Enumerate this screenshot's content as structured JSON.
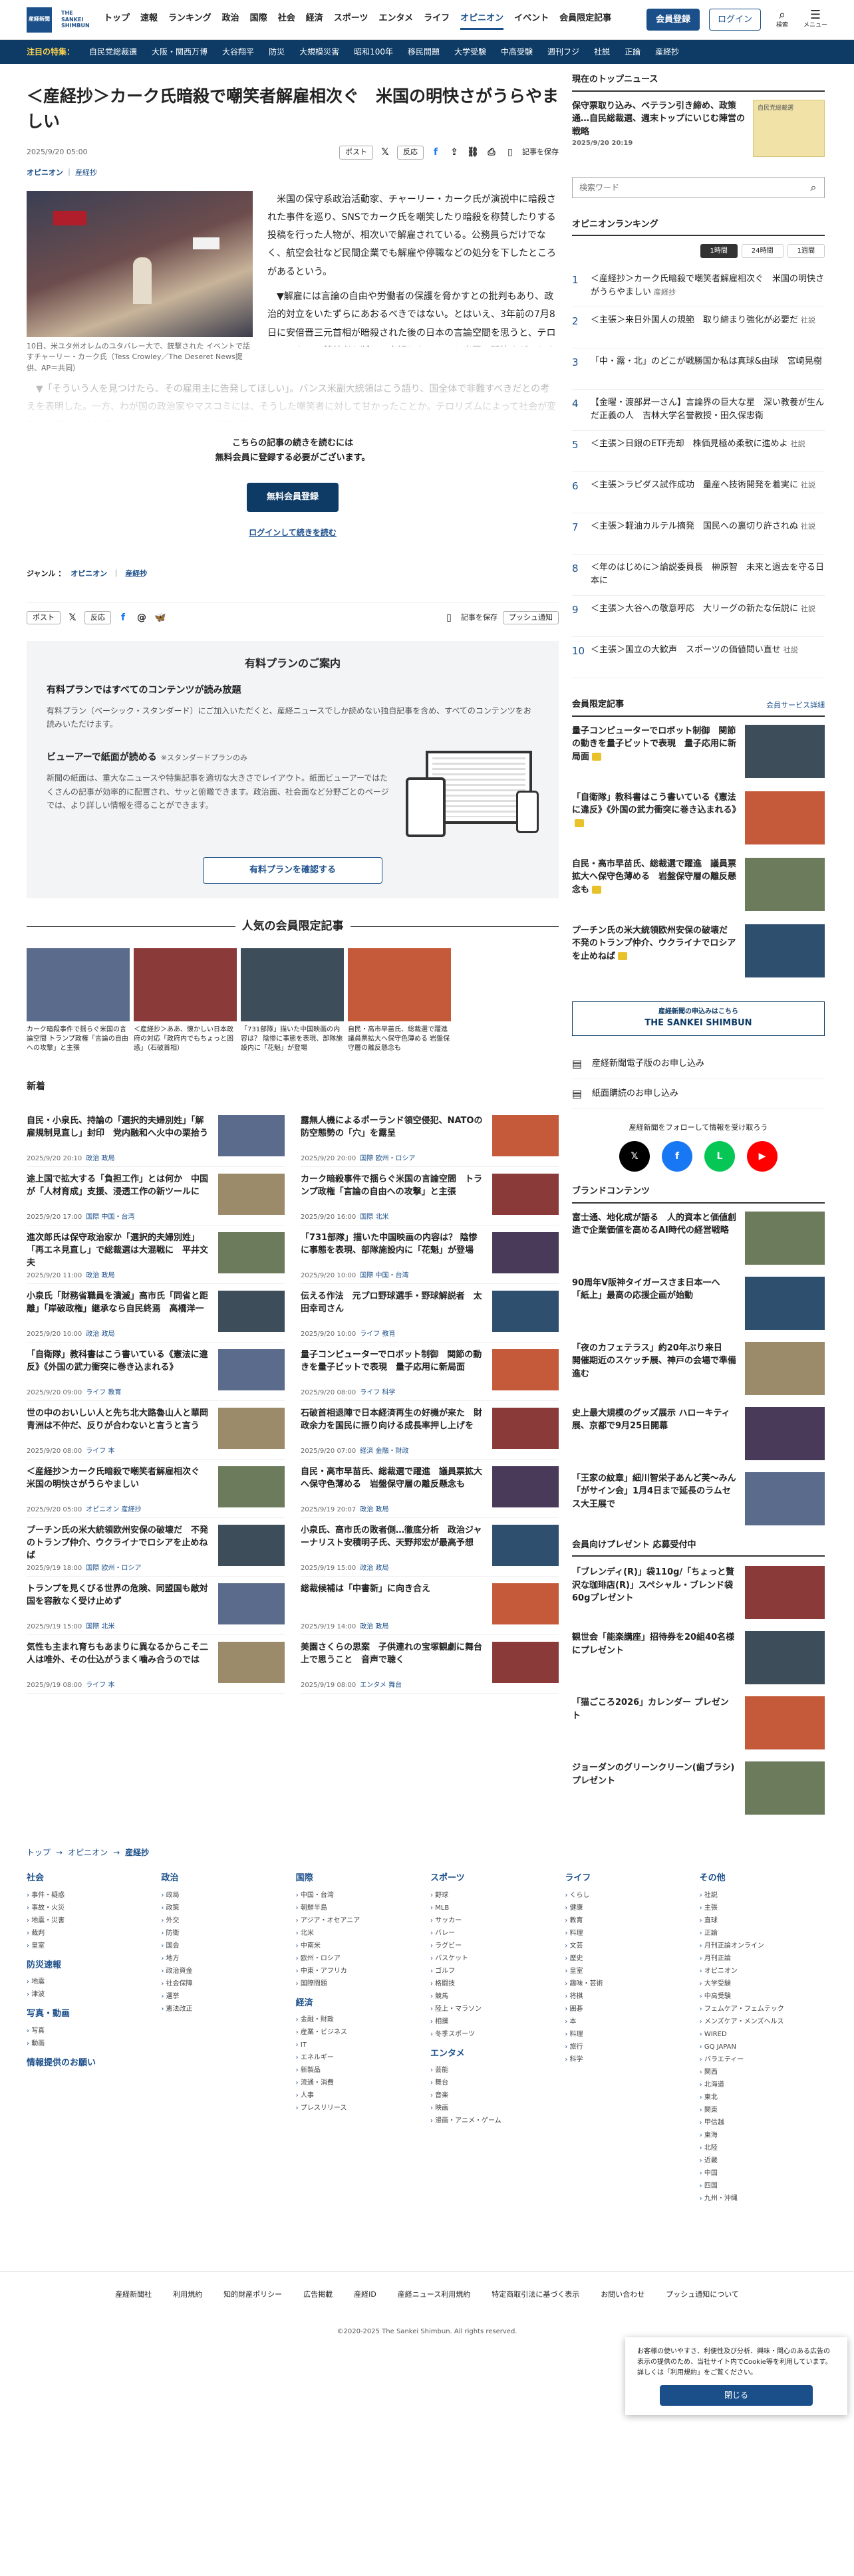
{
  "header": {
    "logo_line1": "産経",
    "logo_line2": "新聞",
    "logo_text": "THE SANKEI SHIMBUN",
    "nav": [
      "トップ",
      "速報",
      "ランキング",
      "政治",
      "国際",
      "社会",
      "経済",
      "スポーツ",
      "エンタメ",
      "ライフ",
      "オピニオン",
      "イベント",
      "会員限定記事"
    ],
    "register": "会員登録",
    "login": "ログイン",
    "search_label": "検索",
    "menu_label": "メニュー"
  },
  "topics": {
    "label": "注目の特集：",
    "items": [
      "自民党総裁選",
      "大阪・関西万博",
      "大谷翔平",
      "防災",
      "大規模災害",
      "昭和100年",
      "移民問題",
      "大学受験",
      "中高受験",
      "週刊フジ",
      "社説",
      "正論",
      "産経抄"
    ]
  },
  "article": {
    "title": "＜産経抄＞カーク氏暗殺で嘲笑者解雇相次ぐ　米国の明快さがうらやましい",
    "date": "2025/9/20 05:00",
    "category": "オピニオン",
    "subcategory": "産経抄",
    "share": {
      "post": "ポスト",
      "react": "反応",
      "save": "記事を保存"
    },
    "caption": "10日、米ユタ州オレムのユタバレー大で、銃撃された イベントで話すチャーリー・カーク氏（Tess Crowley／The Deseret News提供、AP＝共同）",
    "p1": "米国の保守系政治活動家、チャーリー・カーク氏が演説中に暗殺された事件を巡り、SNSでカーク氏を嘲笑したり暗殺を称賛したりする投稿を行った人物が、相次いで解雇されている。公務員らだけでなく、航空会社など民間企業でも解雇や停職などの処分を下したところがあるという。",
    "p2": "▼解雇には言論の自由や労働者の保護を脅かすとの批判もあり、政治的対立をいたずらにあおるべきではない。とはいえ、3年前の7月8日に安倍晋三元首相が暗殺された後の日本の言論空間を思うと、テロリストもその賛美者も断じて容認しないという米国の明快さがうらやましい。",
    "p3": "▼「そういう人を見つけたら、その雇用主に告発してほしい」。バンス米副大統領はこう語り、国全体で非難すべきだとの考えを表明した。一方、わが国の政治家やマスコミには、そうした嘲笑者に対して甘かったことか。テロリズムによって社会が変容し、民主主義が揺さぶられていくことに危機感を抱いた"
  },
  "paywall": {
    "line1": "こちらの記事の続きを読むには",
    "line2": "無料会員に登録する必要がございます。",
    "button": "無料会員登録",
    "login": "ログインして続きを読む"
  },
  "genre": {
    "label": "ジャンル ：",
    "cat": "オピニオン",
    "sub": "産経抄"
  },
  "share2": {
    "post": "ポスト",
    "react": "反応",
    "save": "記事を保存",
    "push": "プッシュ通知"
  },
  "plan": {
    "title": "有料プランのご案内",
    "h1": "有料プランではすべてのコンテンツが読み放題",
    "t1": "有料プラン（ベーシック・スタンダード）にご加入いただくと、産経ニュースでしか読めない独自記事を含め、すべてのコンテンツをお読みいただけます。",
    "h2": "ビューアーで紙面が読める",
    "tag2": "※スタンダードプランのみ",
    "t2": "新聞の紙面は、重大なニュースや特集記事を適切な大きさでレイアウト。紙面ビューアーではたくさんの記事が効率的に配置され、サッと俯瞰できます。政治面、社会面など分野ごとのページでは、より詳しい情報を得ることができます。",
    "button": "有料プランを確認する"
  },
  "popular": {
    "title": "人気の会員限定記事",
    "items": [
      "カーク暗殺事件で揺らぐ米国の言論空間 トランプ政権「言論の自由への攻撃」と主張",
      "＜産経抄＞ああ、懐かしい日本政府の対応「政府内でもちょっと困惑」（石破首相）",
      "「731部隊」描いた中国映画の内容は？ 陰惨に事態を表現、部隊施設内に「花魁」が登場",
      "自民・高市早苗氏、総裁選で躍進 議員票拡大へ保守色薄める 岩盤保守層の離反懸念も"
    ]
  },
  "news": {
    "title": "新着",
    "items": [
      {
        "t": "自民・小泉氏、持論の「選択的夫婦別姓」「解雇規制見直し」封印　党内融和へ火中の栗拾う",
        "d": "2025/9/20 20:10",
        "k": "政治 政局"
      },
      {
        "t": "露無人機によるポーランド領空侵犯、NATOの防空態勢の「穴」を露呈",
        "d": "2025/9/20 20:00",
        "k": "国際 欧州・ロシア"
      },
      {
        "t": "途上国で拡大する「負担工作」とは何か　中国が「人材育成」支援、浸透工作の新ツールに",
        "d": "2025/9/20 17:00",
        "k": "国際 中国・台湾"
      },
      {
        "t": "カーク暗殺事件で揺らぐ米国の言論空間　トランプ政権「言論の自由への攻撃」と主張",
        "d": "2025/9/20 16:00",
        "k": "国際 北米"
      },
      {
        "t": "進次郎氏は保守政治家か「選択的夫婦別姓」「再エネ見直し」で総裁選は大混戦に　平井文夫",
        "d": "2025/9/20 11:00",
        "k": "政治 政局"
      },
      {
        "t": "「731部隊」描いた中国映画の内容は？ 陰惨に事態を表現、部隊施設内に「花魁」が登場",
        "d": "2025/9/20 10:00",
        "k": "国際 中国・台湾"
      },
      {
        "t": "小泉氏「財務省職員を潰滅」高市氏「同省と距離」「岸破政権」継承なら自民終焉　高橋洋一",
        "d": "2025/9/20 10:00",
        "k": "政治 政局"
      },
      {
        "t": "伝える作法　元プロ野球選手・野球解説者　太田幸司さん",
        "d": "2025/9/20 10:00",
        "k": "ライフ 教育"
      },
      {
        "t": "「自衛隊」教科書はこう書いている《憲法に違反》《外国の武力衝突に巻き込まれる》",
        "d": "2025/9/20 09:00",
        "k": "ライフ 教育"
      },
      {
        "t": "量子コンピューターでロボット制御　関節の動きを量子ビットで表現　量子応用に新局面",
        "d": "2025/9/20 08:00",
        "k": "ライフ 科学"
      },
      {
        "t": "世の中のおいしい人と先ち北大路魯山人と華岡青洲は不仲だ、反りが合わないと言うと言う",
        "d": "2025/9/20 08:00",
        "k": "ライフ 本"
      },
      {
        "t": "石破首相退陣で日本経済再生の好機が来た　財政余力を国民に振り向ける成長率押し上げを",
        "d": "2025/9/20 07:00",
        "k": "経済 金融・財政"
      },
      {
        "t": "＜産経抄＞カーク氏暗殺で嘲笑者解雇相次ぐ　米国の明快さがうらやましい",
        "d": "2025/9/20 05:00",
        "k": "オピニオン 産経抄"
      },
      {
        "t": "自民・高市早苗氏、総裁選で躍進　議員票拡大へ保守色薄める　岩盤保守層の離反懸念も",
        "d": "2025/9/19 20:07",
        "k": "政治 政局"
      },
      {
        "t": "プーチン氏の米大統領欧州安保の破壊だ　不発のトランプ仲介、ウクライナでロシアを止めねば",
        "d": "2025/9/19 18:00",
        "k": "国際 欧州・ロシア"
      },
      {
        "t": "小泉氏、高市氏の敗者側…徹底分析　政治ジャーナリスト安積明子氏、天野邦宏が最高予想",
        "d": "2025/9/19 15:00",
        "k": "政治 政局"
      },
      {
        "t": "トランプを見くびる世界の危険、同盟国も敵対国を容赦なく受け止めず",
        "d": "2025/9/19 15:00",
        "k": "国際 北米"
      },
      {
        "t": "総裁候補は「中書新」に向き合え",
        "d": "2025/9/19 14:00",
        "k": "政治 政局"
      },
      {
        "t": "気性も主まれ育ちもあまりに異なるからこそ二人は唯外、その仕込がうまく噛み合うのでは",
        "d": "2025/9/19 08:00",
        "k": "ライフ 本"
      },
      {
        "t": "美園さくらの思案　子供連れの宝塚観劇に舞台上で思うこと　音声で聴く",
        "d": "2025/9/19 08:00",
        "k": "エンタメ 舞台"
      }
    ]
  },
  "breadcrumb": {
    "top": "トップ",
    "cat": "オピニオン",
    "sub": "産経抄"
  },
  "sitemap": [
    {
      "h": "社会",
      "items": [
        "事件・疑惑",
        "事故・火災",
        "地震・災害",
        "裁判",
        "皇室"
      ],
      "h2": "防災速報",
      "items2": [
        "地震",
        "津波"
      ],
      "h3": "写真・動画",
      "items3": [
        "写真",
        "動画"
      ],
      "h4": "情報提供のお願い"
    },
    {
      "h": "政治",
      "items": [
        "政局",
        "政策",
        "外交",
        "防衛",
        "国会",
        "地方",
        "政治資金",
        "社会保障",
        "選挙",
        "憲法改正"
      ]
    },
    {
      "h": "国際",
      "items": [
        "中国・台湾",
        "朝鮮半島",
        "アジア・オセアニア",
        "北米",
        "中南米",
        "欧州・ロシア",
        "中東・アフリカ",
        "国際問題"
      ],
      "h2": "経済",
      "items2": [
        "金融・財政",
        "産業・ビジネス",
        "IT",
        "エネルギー",
        "新製品",
        "流通・消費",
        "人事",
        "プレスリリース"
      ]
    },
    {
      "h": "スポーツ",
      "items": [
        "野球",
        "MLB",
        "サッカー",
        "バレー",
        "ラグビー",
        "バスケット",
        "ゴルフ",
        "格闘技",
        "競馬",
        "陸上・マラソン",
        "相撲",
        "冬季スポーツ"
      ],
      "h2": "エンタメ",
      "items2": [
        "芸能",
        "舞台",
        "音楽",
        "映画",
        "漫画・アニメ・ゲーム"
      ]
    },
    {
      "h": "ライフ",
      "items": [
        "くらし",
        "健康",
        "教育",
        "料理",
        "文芸",
        "歴史",
        "皇室",
        "趣味・芸術",
        "将棋",
        "囲碁",
        "本",
        "料理",
        "旅行",
        "科学"
      ]
    },
    {
      "h": "その他",
      "items": [
        "社説",
        "主張",
        "直球",
        "正論",
        "月刊正論オンライン",
        "月刊正論",
        "オピニオン",
        "大学受験",
        "中高受験",
        "フェムケア・フェムテック",
        "メンズケア・メンズヘルス",
        "WIRED",
        "GQ JAPAN",
        "バラエティー",
        "関西",
        "北海道",
        "東北",
        "関東",
        "甲信越",
        "東海",
        "北陸",
        "近畿",
        "中国",
        "四国",
        "九州・沖縄"
      ]
    }
  ],
  "footer": {
    "links": [
      "産経新聞社",
      "利用規約",
      "知的財産ポリシー",
      "広告掲載",
      "産経ID",
      "産経ニュース利用規約",
      "特定商取引法に基づく表示",
      "お問い合わせ",
      "プッシュ通知について"
    ],
    "copyright": "©2020-2025 The Sankei Shimbun. All rights reserved."
  },
  "cookie": {
    "text": "お客様の使いやすさ、利便性及び分析、興味・関心のある広告の表示の提供のため、当社サイト内でCookie等を利用しています。詳しくは「利用規約」をご覧ください。",
    "button": "閉じる"
  },
  "side": {
    "topnews_title": "現在のトップニュース",
    "topnews": {
      "t": "保守票取り込み、ベテラン引き締め、政策通…自民総裁選、週末トップにいじむ陣営の戦略",
      "d": "2025/9/20 20:19",
      "bn": "自民党総裁選"
    },
    "search_placeholder": "検索ワード",
    "ranking_title": "オピニオンランキング",
    "tabs": [
      "1時間",
      "24時間",
      "1週間"
    ],
    "ranking": [
      {
        "t": "＜産経抄＞カーク氏暗殺で嘲笑者解雇相次ぐ　米国の明快さがうらやましい",
        "c": "産経抄"
      },
      {
        "t": "＜主張＞来日外国人の規範　取り締まり強化が必要だ",
        "c": "社説"
      },
      {
        "t": "「中・露・北」のどこが戦勝国か私は真球&由球　宮崎晃樹",
        "c": ""
      },
      {
        "t": "【金曜・渡部昇一さん】言論界の巨大な星　深い教養が生んだ正義の人　吉林大学名誉教授・田久保忠衛",
        "c": ""
      },
      {
        "t": "＜主張＞日銀のETF売却　株価見極め柔軟に進めよ",
        "c": "社説"
      },
      {
        "t": "＜主張＞ラピダス試作成功　量産へ技術開発を着実に",
        "c": "社説"
      },
      {
        "t": "＜主張＞軽油カルテル摘発　国民への裏切り許されぬ",
        "c": "社説"
      },
      {
        "t": "＜年のはじめに＞論説委員長　榊原智　未来と過去を守る日本に",
        "c": ""
      },
      {
        "t": "＜主張＞大谷への敬意呼応　大リーグの新たな伝説に",
        "c": "社説"
      },
      {
        "t": "＜主張＞国立の大歓声　スポーツの価値問い直せ",
        "c": "社説"
      }
    ],
    "member_title": "会員限定記事",
    "member_link": "会員サービス詳細",
    "members": [
      "量子コンピューターでロボット制御　関節の動きを量子ビットで表現　量子応用に新局面",
      "「自衛隊」教科書はこう書いている《憲法に違反》《外国の武力衝突に巻き込まれる》",
      "自民・高市早苗氏、総裁選で躍進　議員票拡大へ保守色薄める　岩盤保守層の離反懸念も",
      "プーチン氏の米大統領欧州安保の破壊だ　不発のトランプ仲介、ウクライナでロシアを止めねば"
    ],
    "banner_small": "産経新聞の申込みはこちら",
    "banner_big": "THE SANKEI SHIMBUN",
    "services": [
      "産経新聞電子版のお申し込み",
      "紙面購読のお申し込み"
    ],
    "follow": "産経新聞をフォローして情報を受け取ろう",
    "brand_title": "ブランドコンテンツ",
    "brands": [
      "富士通、地化成が語る　人的資本と価値創造で企業価値を高めるAI時代の経営戦略",
      "90周年V阪神タイガースさま日本一へ「紙上」最高の応援企画が始動",
      "「夜のカフェテラス」約20年ぶり来日　開催期近のスケッチ展、神戸の会場で準備進む",
      "史上最大規模のグッズ展示 ハローキティ展、京都で9月25日開幕",
      "「王家の紋章」細川智栄子あんど芙〜みん「がサイン会」1月4日まで延長のラムセス大王展で"
    ],
    "present_title": "会員向けプレゼント 応募受付中",
    "presents": [
      "「ブレンディ(R)」袋110g/「ちょっと贅沢な珈琲店(R)」スペシャル・ブレンド袋60gプレゼント",
      "観世会「能楽講座」招待券を20組40名様にプレゼント",
      "「猫ごころ2026」カレンダー プレゼント",
      "ジョーダンのグリーンクリーン(歯ブラシ)プレゼント"
    ]
  }
}
